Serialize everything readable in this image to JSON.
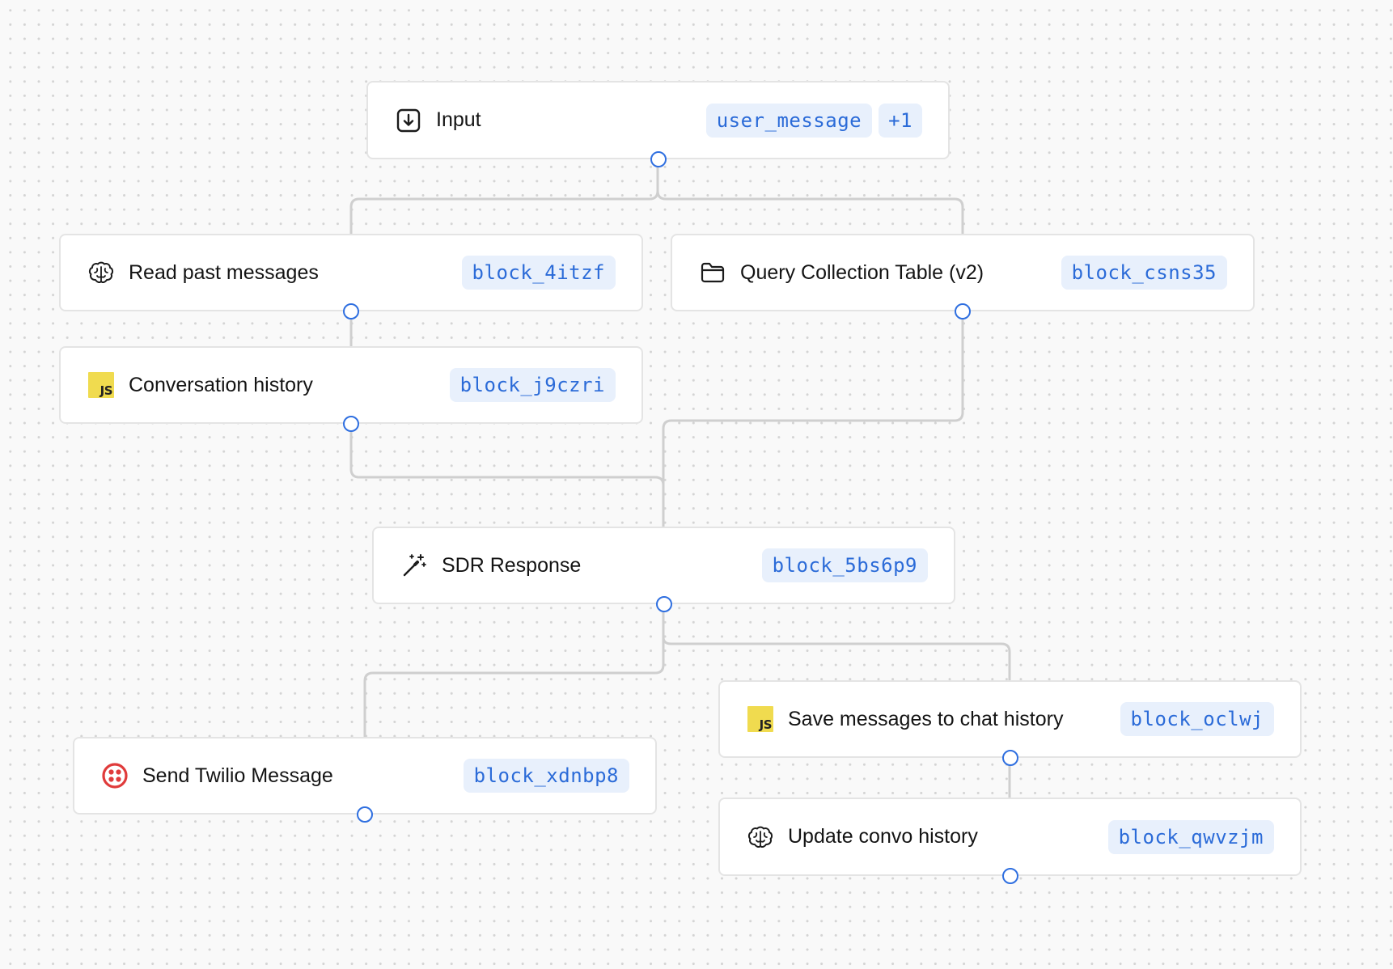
{
  "colors": {
    "edge": "#cfcfcf",
    "port": "#2f6fe0",
    "badge_text": "#2b6bd8",
    "badge_bg": "#e8f0fc",
    "node_border": "#e4e4e4",
    "js_icon": "#f0db4f",
    "twilio_icon": "#e03b3b"
  },
  "nodes": {
    "input": {
      "label": "Input",
      "icon": "download-box-icon",
      "badges": [
        "user_message",
        "+1"
      ]
    },
    "read_past": {
      "label": "Read past messages",
      "icon": "brain-icon",
      "badge": "block_4itzf"
    },
    "query_collection": {
      "label": "Query Collection Table (v2)",
      "icon": "folder-icon",
      "badge": "block_csns35"
    },
    "conversation_history": {
      "label": "Conversation history",
      "icon": "javascript-icon",
      "icon_text": "JS",
      "badge": "block_j9czri"
    },
    "sdr_response": {
      "label": "SDR Response",
      "icon": "magic-wand-icon",
      "badge": "block_5bs6p9"
    },
    "save_messages": {
      "label": "Save messages to chat history",
      "icon": "javascript-icon",
      "icon_text": "JS",
      "badge": "block_oclwj"
    },
    "send_twilio": {
      "label": "Send Twilio Message",
      "icon": "twilio-icon",
      "badge": "block_xdnbp8"
    },
    "update_convo": {
      "label": "Update convo history",
      "icon": "brain-icon",
      "badge": "block_qwvzjm"
    }
  }
}
